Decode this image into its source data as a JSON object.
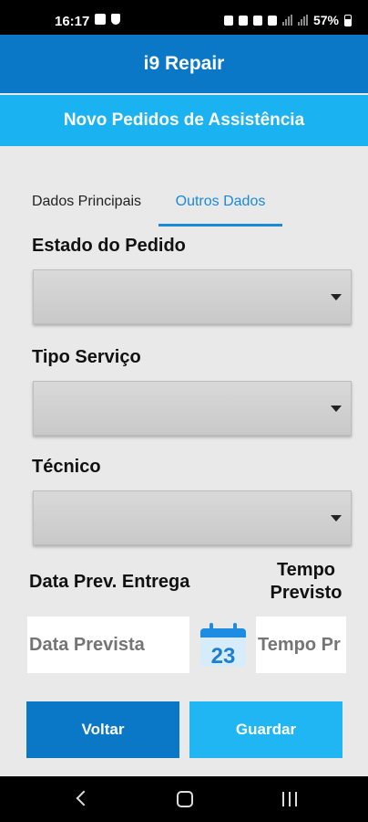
{
  "status": {
    "time": "16:17",
    "battery": "57%"
  },
  "app": {
    "title": "i9 Repair",
    "subtitle": "Novo Pedidos de Assistência"
  },
  "tabs": [
    {
      "label": "Dados Principais",
      "active": false
    },
    {
      "label": "Outros Dados",
      "active": true
    }
  ],
  "form": {
    "estado_label": "Estado do Pedido",
    "estado_value": "",
    "tipo_label": "Tipo Serviço",
    "tipo_value": "",
    "tecnico_label": "Técnico",
    "tecnico_value": "",
    "data_label": "Data Prev. Entrega",
    "data_placeholder": "Data Prevista",
    "tempo_label_line1": "Tempo",
    "tempo_label_line2": "Previsto",
    "tempo_placeholder": "Tempo Pr",
    "calendar_day": "23"
  },
  "buttons": {
    "back": "Voltar",
    "save": "Guardar"
  },
  "colors": {
    "app_bar": "#0a78c6",
    "sub_bar": "#1ab2f0",
    "tab_active": "#1a8ad6",
    "save_button": "#20b6f3"
  }
}
